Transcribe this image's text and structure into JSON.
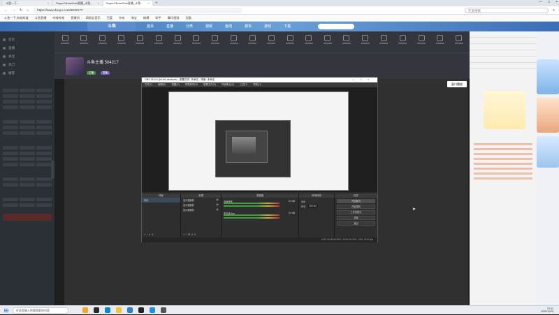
{
  "browser": {
    "tabs": [
      {
        "label": "斗鱼一下..."
      },
      {
        "label": "SuperClimaxSolo直播_斗鱼..."
      },
      {
        "label": "SuperClimaxSolo直播_斗鱼..."
      }
    ],
    "url": "https://www.douyu.com/504217?",
    "search_placeholder": "在此搜索",
    "bookmarks": [
      "斗鱼一下,你就知道",
      "斗鱼直播",
      "哔哩哔哩",
      "直播间",
      "网易云音乐",
      "百度",
      "京东",
      "淘宝",
      "微博",
      "知乎",
      "腾讯视频",
      "优酷"
    ]
  },
  "site": {
    "nav": [
      "首页",
      "直播",
      "分类",
      "视频",
      "鱼吧",
      "赛事",
      "游戏",
      "下载"
    ]
  },
  "sidebar": {
    "items": [
      "首页",
      "直播",
      "关注",
      "热门",
      "推荐"
    ]
  },
  "streamer": {
    "name": "斗鱼主播 504217",
    "tags": [
      "主播",
      "直播"
    ]
  },
  "obs": {
    "title": "OBS 25.0.8 (64-bit, windows) - 配置文件: 未命名 - 场景: 未命名",
    "menu": [
      "文件(F)",
      "编辑(E)",
      "视图(V)",
      "停靠部件(D)",
      "配置文件(P)",
      "场景集合(S)",
      "工具(T)",
      "帮助(H)"
    ],
    "docks": {
      "scenes": "场景",
      "sources": "来源",
      "mixer": "混音器",
      "transitions": "转场特效",
      "controls": "控件"
    },
    "scene_items": [
      "场景"
    ],
    "source_items": [
      "显示器捕获",
      "显示器捕获",
      "显示器捕获"
    ],
    "mixer_items": [
      {
        "name": "桌面音频",
        "db": "0.0 dB"
      },
      {
        "name": "麦克风/Aux",
        "db": "0.0 dB"
      }
    ],
    "transition": {
      "type": "淡出",
      "duration_label": "时长",
      "duration": "300 ms"
    },
    "controls": [
      "开始推流",
      "开始录制",
      "工作室模式",
      "设置",
      "退出"
    ],
    "status": "LIVE: 00:00:00   REC: 00:00:00   CPU: 1.9%, 30.00 fps"
  },
  "player": {
    "corner_button": "窗口播放"
  },
  "taskbar": {
    "search_placeholder": "在这里输入你要搜索的内容",
    "time": "23:01",
    "date": "2020/11/25"
  }
}
